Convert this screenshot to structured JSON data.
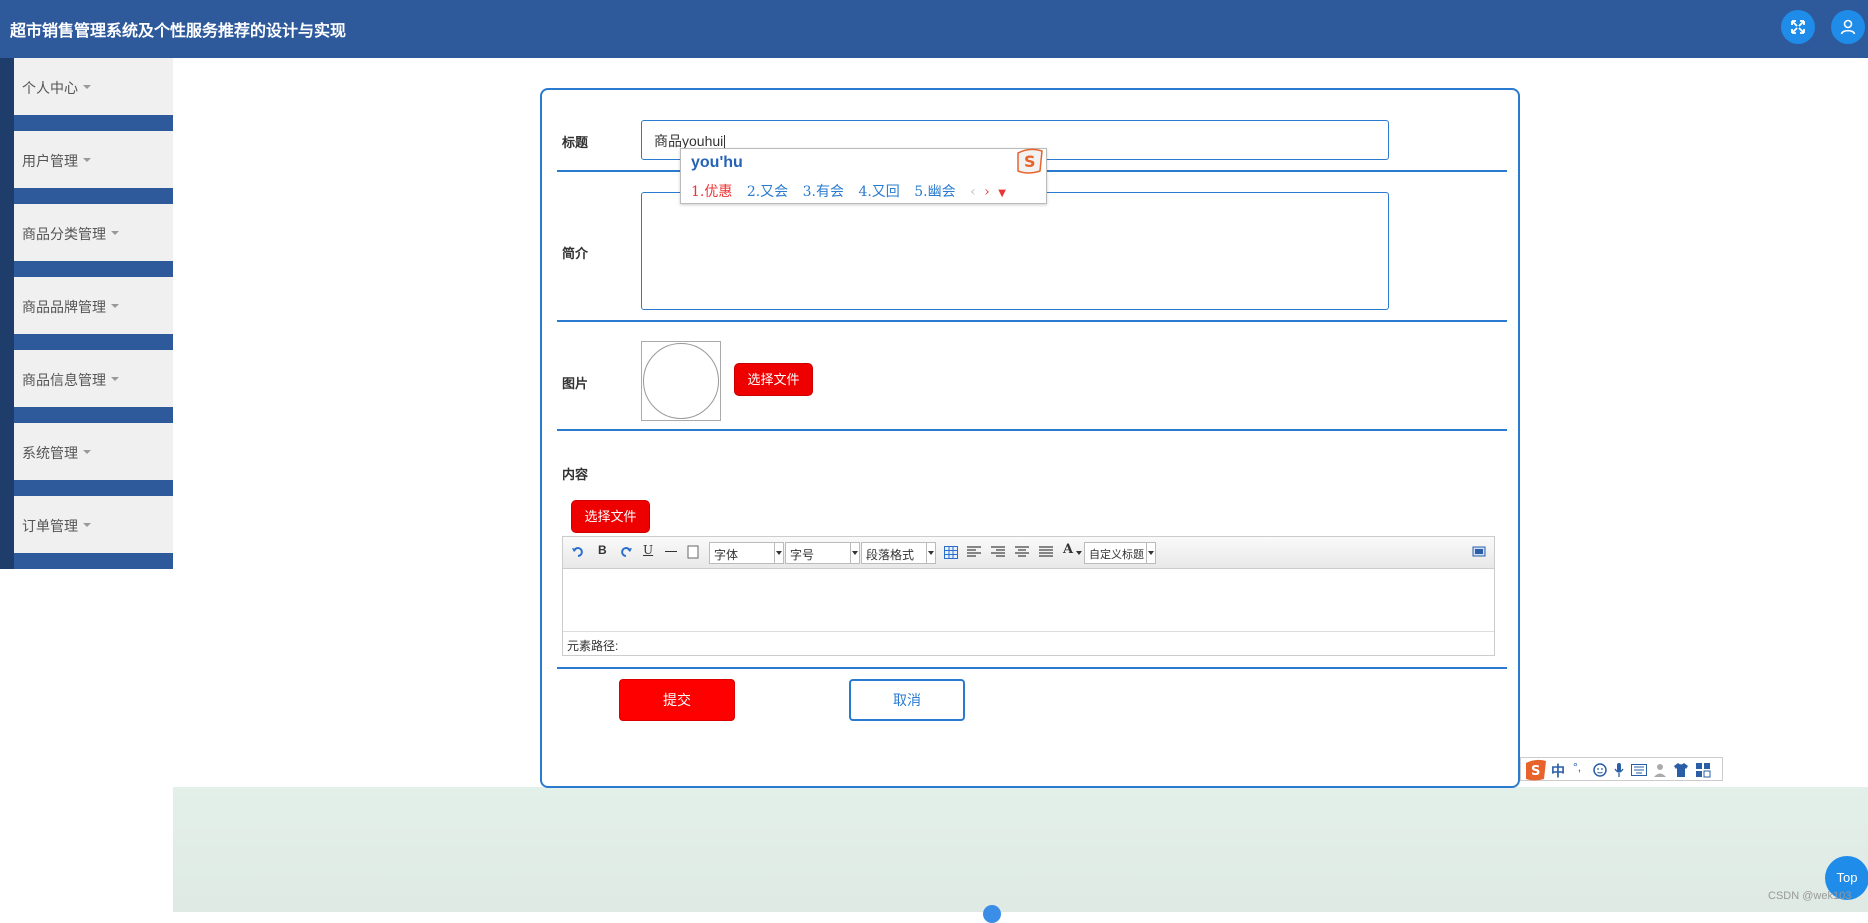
{
  "app": {
    "title": "超市销售管理系统及个性服务推荐的设计与实现",
    "fullscreen_icon": "fullscreen-icon",
    "user_icon": "user-icon"
  },
  "sidebar": {
    "items": [
      {
        "label": "个人中心"
      },
      {
        "label": "用户管理"
      },
      {
        "label": "商品分类管理"
      },
      {
        "label": "商品品牌管理"
      },
      {
        "label": "商品信息管理"
      },
      {
        "label": "系统管理"
      },
      {
        "label": "订单管理"
      }
    ]
  },
  "form": {
    "title_label": "标题",
    "title_value": "商品youhui",
    "intro_label": "简介",
    "intro_value": "",
    "image_label": "图片",
    "image_choose_button": "选择文件",
    "content_label": "内容",
    "content_choose_button": "选择文件",
    "submit_button": "提交",
    "cancel_button": "取消"
  },
  "editor": {
    "font_family_select": "字体",
    "font_size_select": "字号",
    "paragraph_select": "段落格式",
    "custom_title_select": "自定义标题",
    "font_color_button": "A",
    "bold_button": "B",
    "underline_button": "U",
    "element_path_label": "元素路径:"
  },
  "ime": {
    "pinyin": "you'hu",
    "candidates": [
      "1.优惠",
      "2.又会",
      "3.有会",
      "4.又回",
      "5.幽会"
    ],
    "bar_chinese_mode": "中"
  },
  "misc": {
    "top_button": "Top",
    "watermark": "CSDN @wek103"
  },
  "colors": {
    "header_bg": "#2e5a9c",
    "accent_blue": "#2a7bd0",
    "button_red": "#ee0000"
  }
}
